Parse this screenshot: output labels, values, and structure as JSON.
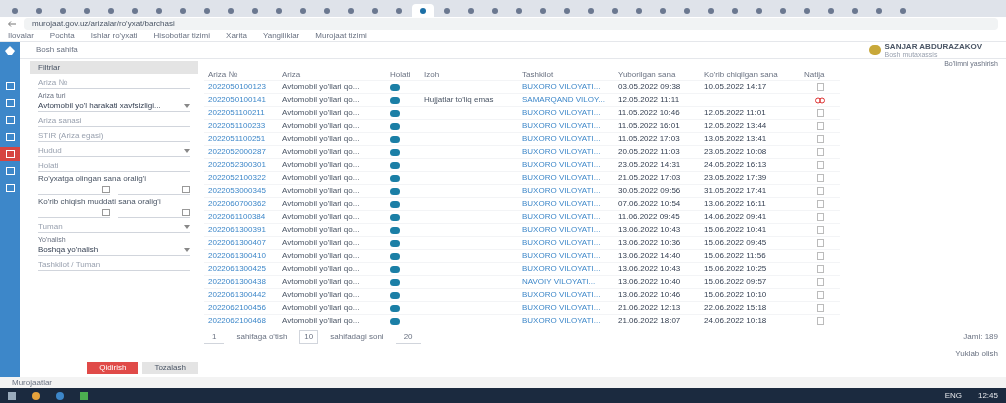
{
  "browser": {
    "tabs": [
      {
        "selected": false
      },
      {
        "selected": false
      },
      {
        "selected": false
      },
      {
        "selected": false
      },
      {
        "selected": false
      },
      {
        "selected": false
      },
      {
        "selected": false
      },
      {
        "selected": false
      },
      {
        "selected": false
      },
      {
        "selected": false
      },
      {
        "selected": false
      },
      {
        "selected": false
      },
      {
        "selected": false
      },
      {
        "selected": false
      },
      {
        "selected": false
      },
      {
        "selected": false
      },
      {
        "selected": false
      },
      {
        "selected": true
      },
      {
        "selected": false
      },
      {
        "selected": false
      },
      {
        "selected": false
      },
      {
        "selected": false
      },
      {
        "selected": false
      },
      {
        "selected": false
      },
      {
        "selected": false
      },
      {
        "selected": false
      },
      {
        "selected": false
      },
      {
        "selected": false
      },
      {
        "selected": false
      },
      {
        "selected": false
      },
      {
        "selected": false
      },
      {
        "selected": false
      },
      {
        "selected": false
      },
      {
        "selected": false
      },
      {
        "selected": false
      },
      {
        "selected": false
      },
      {
        "selected": false
      },
      {
        "selected": false
      }
    ],
    "address": "murojaat.gov.uz/arizalar/ro'yxat/barchasi",
    "bookmarks": [
      "Ilovalar",
      "Pochta",
      "Ishlar ro'yxati",
      "Hisobotlar tizimi",
      "Xarita",
      "Yangiliklar",
      "Murojaat tizimi"
    ]
  },
  "header": {
    "nav_label": "Bosh sahifa",
    "user": "SANJAR ABDURAZAKOV",
    "user_role": "Bosh mutaxassis",
    "hide_link": "Bo'limni yashirish"
  },
  "sidebar": {
    "items": [
      {
        "selected": false
      },
      {
        "selected": false
      },
      {
        "selected": false
      },
      {
        "selected": false
      },
      {
        "selected": true
      },
      {
        "selected": false
      },
      {
        "selected": false
      }
    ]
  },
  "filters": {
    "title": "Filtrlar",
    "fields": [
      {
        "kind": "text",
        "placeholder": "Ariza №"
      },
      {
        "kind": "select",
        "label": "Ariza turi",
        "value": "Avtomobil yo'l harakati xavfsizligi..."
      },
      {
        "kind": "text",
        "placeholder": "Ariza sanasi"
      },
      {
        "kind": "text",
        "placeholder": "STIR (Ariza egasi)"
      },
      {
        "kind": "select",
        "placeholder": "Hudud"
      },
      {
        "kind": "text",
        "placeholder": "Holati"
      },
      {
        "kind": "range",
        "label": "Ro'yxatga olingan sana oralig'i"
      },
      {
        "kind": "range",
        "label": "Ko'rib chiqish muddati sana oralig'i"
      },
      {
        "kind": "select",
        "placeholder": "Tuman"
      },
      {
        "kind": "select",
        "label": "Yo'nalish",
        "value": "Boshqa yo'nalish"
      },
      {
        "kind": "text",
        "placeholder": "Tashkilot / Tuman"
      }
    ],
    "search_button": "Qidirish",
    "clear_button": "Tozalash"
  },
  "table": {
    "columns": [
      "Ariza №",
      "Ariza",
      "Holati",
      "Izoh",
      "Tashkilot",
      "Yuborilgan sana",
      "Ko'rib chiqilgan sana",
      "Natija"
    ],
    "rows": [
      {
        "number": "2022050100123",
        "title": "Avtomobil yo'llari qo...",
        "note": "",
        "org": "BUXORO VILOYATI...",
        "sent": "03.05.2022 09:38",
        "done": "10.05.2022 14:17",
        "kind": "ok"
      },
      {
        "number": "2022050100141",
        "title": "Avtomobil yo'llari qo...",
        "note": "Hujjatlar to'liq emas",
        "org": "SAMARQAND VILOY...",
        "sent": "12.05.2022 11:11",
        "done": "",
        "kind": "error"
      },
      {
        "number": "2022051100211",
        "title": "Avtomobil yo'llari qo...",
        "note": "",
        "org": "BUXORO VILOYATI...",
        "sent": "11.05.2022 10:46",
        "done": "12.05.2022 11:01",
        "kind": "ok"
      },
      {
        "number": "2022051100233",
        "title": "Avtomobil yo'llari qo...",
        "note": "",
        "org": "BUXORO VILOYATI...",
        "sent": "11.05.2022 16:01",
        "done": "12.05.2022 13:44",
        "kind": "ok"
      },
      {
        "number": "2022051100251",
        "title": "Avtomobil yo'llari qo...",
        "note": "",
        "org": "BUXORO VILOYATI...",
        "sent": "11.05.2022 17:03",
        "done": "13.05.2022 13:41",
        "kind": "ok"
      },
      {
        "number": "2022052000287",
        "title": "Avtomobil yo'llari qo...",
        "note": "",
        "org": "BUXORO VILOYATI...",
        "sent": "20.05.2022 11:03",
        "done": "23.05.2022 10:08",
        "kind": "ok"
      },
      {
        "number": "2022052300301",
        "title": "Avtomobil yo'llari qo...",
        "note": "",
        "org": "BUXORO VILOYATI...",
        "sent": "23.05.2022 14:31",
        "done": "24.05.2022 16:13",
        "kind": "ok"
      },
      {
        "number": "2022052100322",
        "title": "Avtomobil yo'llari qo...",
        "note": "",
        "org": "BUXORO VILOYATI...",
        "sent": "21.05.2022 17:03",
        "done": "23.05.2022 17:39",
        "kind": "ok"
      },
      {
        "number": "2022053000345",
        "title": "Avtomobil yo'llari qo...",
        "note": "",
        "org": "BUXORO VILOYATI...",
        "sent": "30.05.2022 09:56",
        "done": "31.05.2022 17:41",
        "kind": "ok"
      },
      {
        "number": "2022060700362",
        "title": "Avtomobil yo'llari qo...",
        "note": "",
        "org": "BUXORO VILOYATI...",
        "sent": "07.06.2022 10:54",
        "done": "13.06.2022 16:11",
        "kind": "ok"
      },
      {
        "number": "2022061100384",
        "title": "Avtomobil yo'llari qo...",
        "note": "",
        "org": "BUXORO VILOYATI...",
        "sent": "11.06.2022 09:45",
        "done": "14.06.2022 09:41",
        "kind": "ok"
      },
      {
        "number": "2022061300391",
        "title": "Avtomobil yo'llari qo...",
        "note": "",
        "org": "BUXORO VILOYATI...",
        "sent": "13.06.2022 10:43",
        "done": "15.06.2022 10:41",
        "kind": "ok"
      },
      {
        "number": "2022061300407",
        "title": "Avtomobil yo'llari qo...",
        "note": "",
        "org": "BUXORO VILOYATI...",
        "sent": "13.06.2022 10:36",
        "done": "15.06.2022 09:45",
        "kind": "ok"
      },
      {
        "number": "2022061300410",
        "title": "Avtomobil yo'llari qo...",
        "note": "",
        "org": "BUXORO VILOYATI...",
        "sent": "13.06.2022 14:40",
        "done": "15.06.2022 11:56",
        "kind": "ok"
      },
      {
        "number": "2022061300425",
        "title": "Avtomobil yo'llari qo...",
        "note": "",
        "org": "BUXORO VILOYATI...",
        "sent": "13.06.2022 10:43",
        "done": "15.06.2022 10:25",
        "kind": "ok"
      },
      {
        "number": "2022061300438",
        "title": "Avtomobil yo'llari qo...",
        "note": "",
        "org": "NAVOIY VILOYATI...",
        "sent": "13.06.2022 10:40",
        "done": "15.06.2022 09:57",
        "kind": "ok"
      },
      {
        "number": "2022061300442",
        "title": "Avtomobil yo'llari qo...",
        "note": "",
        "org": "BUXORO VILOYATI...",
        "sent": "13.06.2022 10:46",
        "done": "15.06.2022 10:10",
        "kind": "ok"
      },
      {
        "number": "2022062100456",
        "title": "Avtomobil yo'llari qo...",
        "note": "",
        "org": "BUXORO VILOYATI...",
        "sent": "21.06.2022 12:13",
        "done": "22.06.2022 15:18",
        "kind": "ok"
      },
      {
        "number": "2022062100468",
        "title": "Avtomobil yo'llari qo...",
        "note": "",
        "org": "BUXORO VILOYATI...",
        "sent": "21.06.2022 18:07",
        "done": "24.06.2022 10:18",
        "kind": "ok"
      }
    ]
  },
  "pagination": {
    "page": "1",
    "page_label": "sahifaga o'tish",
    "page_count": "10",
    "per_page_label": "sahifadagi soni",
    "per_page": "20",
    "total": "Jami: 189",
    "export": "Yuklab olish"
  },
  "status_bar": {
    "text": "Murojaatlar"
  },
  "taskbar": {
    "tray": [
      "ENG",
      "12:45"
    ]
  }
}
